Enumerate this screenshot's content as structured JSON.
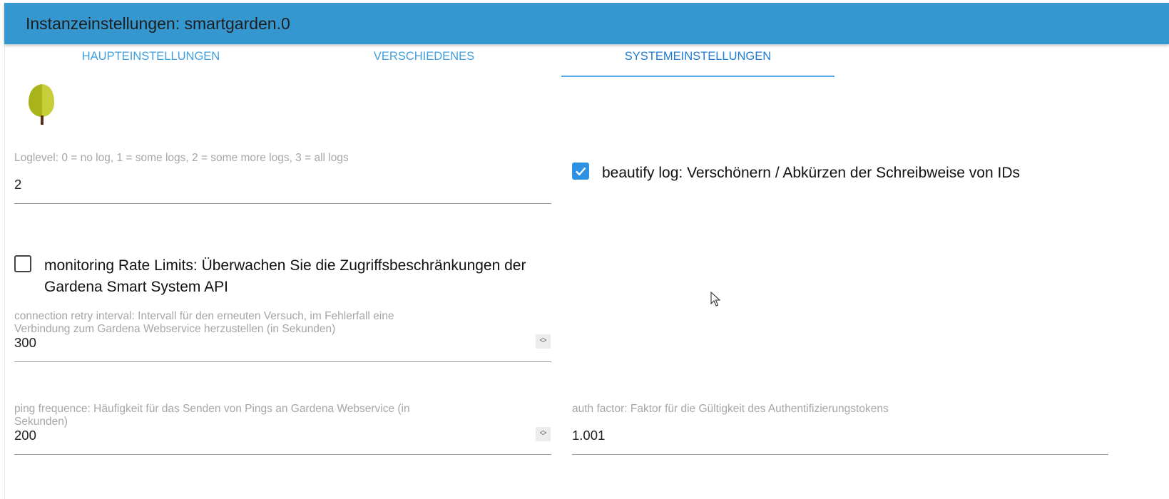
{
  "header": {
    "title": "Instanzeinstellungen: smartgarden.0"
  },
  "tabs": [
    {
      "label": "HAUPTEINSTELLUNGEN",
      "active": false
    },
    {
      "label": "VERSCHIEDENES",
      "active": false
    },
    {
      "label": "SYSTEMEINSTELLUNGEN",
      "active": true
    }
  ],
  "logo": {
    "icon": "tree-icon",
    "colors": [
      "#a8b41a",
      "#c6cf3a",
      "#5a2e1c"
    ]
  },
  "loglevel": {
    "label": "Loglevel: 0 = no log, 1 = some logs, 2 = some more logs, 3 = all logs",
    "value": "2"
  },
  "beautify": {
    "label": "beautify log: Verschönern / Abkürzen der Schreibweise von IDs",
    "checked": true
  },
  "monitoring": {
    "label_line1": "monitoring Rate Limits: Überwachen Sie die Zugriffsbeschränkungen der",
    "label_line2": "Gardena Smart System API",
    "checked": false
  },
  "retry": {
    "label_line1": "connection retry interval: Intervall für den erneuten Versuch, im Fehlerfall eine",
    "label_line2": "Verbindung zum Gardena Webservice herzustellen (in Sekunden)",
    "value": "300"
  },
  "ping": {
    "label_line1": "ping frequence: Häufigkeit für das Senden von Pings an Gardena Webservice (in",
    "label_line2": "Sekunden)",
    "value": "200"
  },
  "auth": {
    "label": "auth factor: Faktor für die Gültigkeit des Authentifizierungstokens",
    "value": "1.001"
  },
  "colors": {
    "header": "#3597d0",
    "tab": "#3e9ee0",
    "tab_active": "#1d7bd3",
    "checkbox_checked": "#2f91e3"
  }
}
